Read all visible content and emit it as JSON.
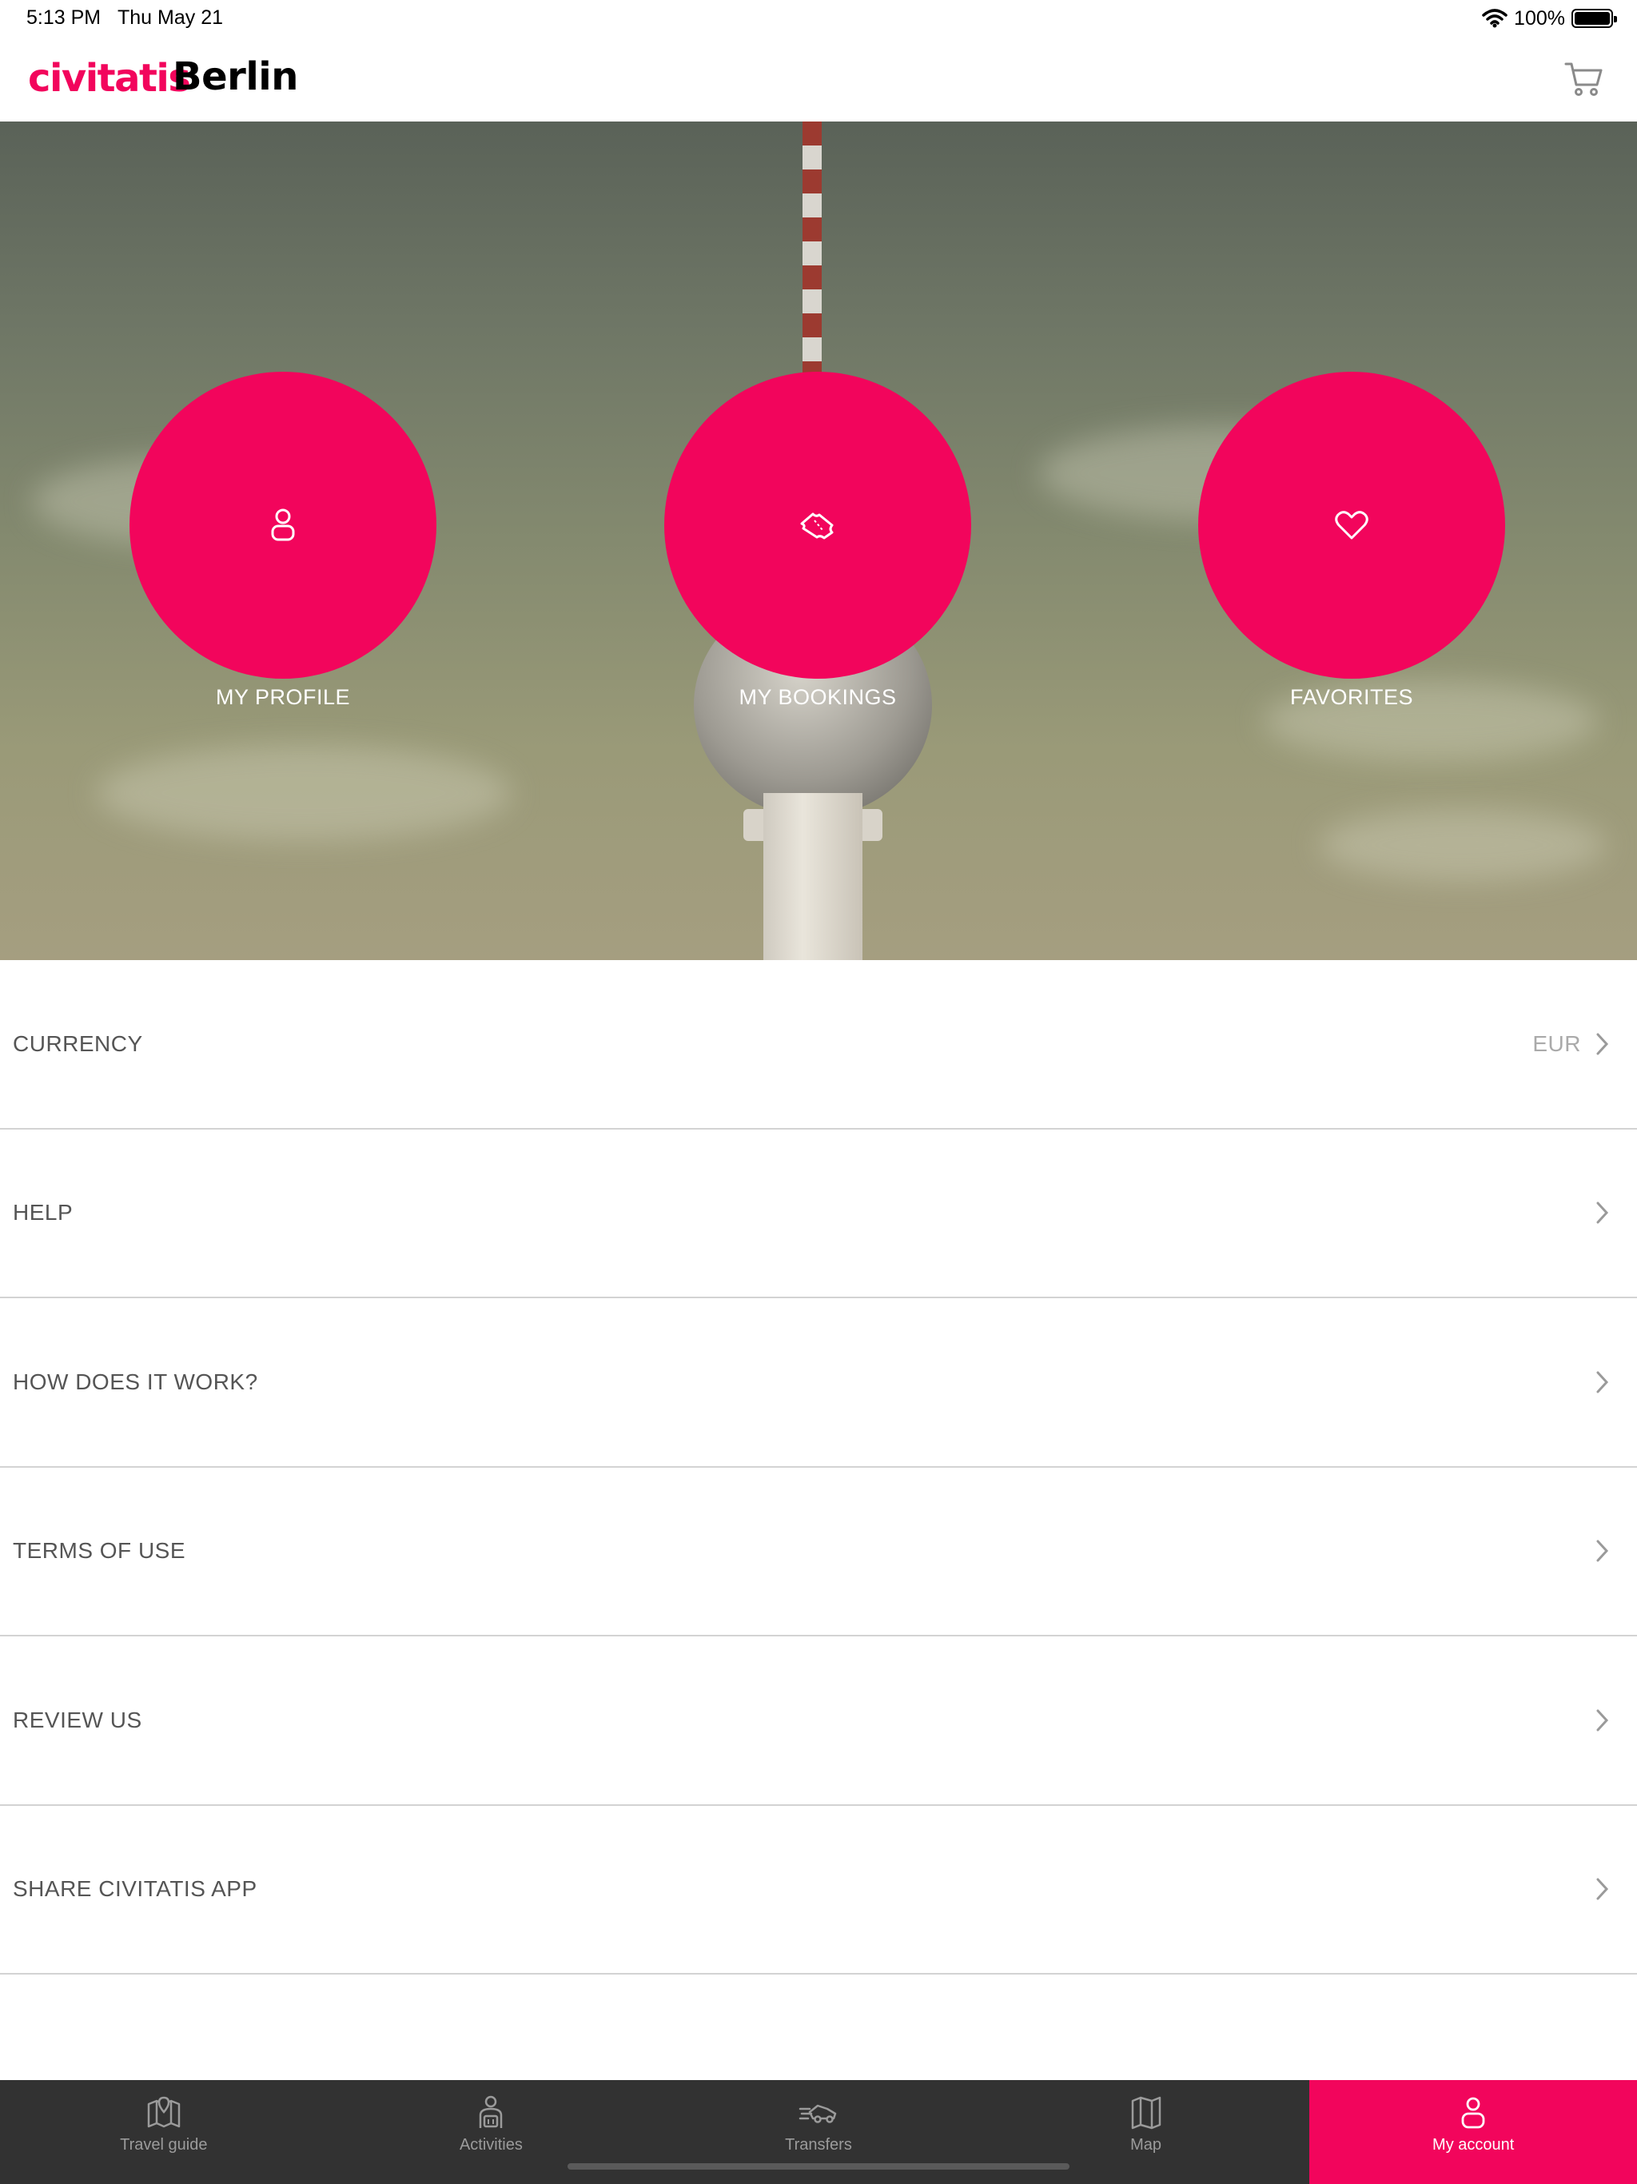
{
  "status_bar": {
    "time": "5:13 PM",
    "date": "Thu May 21",
    "battery": "100%"
  },
  "header": {
    "logo": "civitatis",
    "city": "Berlin"
  },
  "hero": {
    "actions": [
      {
        "label": "MY PROFILE",
        "icon": "person-icon"
      },
      {
        "label": "MY BOOKINGS",
        "icon": "ticket-icon"
      },
      {
        "label": "FAVORITES",
        "icon": "heart-icon"
      }
    ]
  },
  "menu": {
    "items": [
      {
        "label": "CURRENCY",
        "value": "EUR"
      },
      {
        "label": "HELP"
      },
      {
        "label": "HOW DOES IT WORK?"
      },
      {
        "label": "TERMS OF USE"
      },
      {
        "label": "REVIEW US"
      },
      {
        "label": "SHARE CIVITATIS APP"
      }
    ]
  },
  "tabbar": {
    "tabs": [
      {
        "label": "Travel guide",
        "icon": "guide-map-icon"
      },
      {
        "label": "Activities",
        "icon": "traveler-icon"
      },
      {
        "label": "Transfers",
        "icon": "transfer-car-icon"
      },
      {
        "label": "Map",
        "icon": "map-icon"
      },
      {
        "label": "My account",
        "icon": "person-icon",
        "active": true
      }
    ]
  },
  "colors": {
    "brand": "#f2055c",
    "tabbar_bg": "#323232"
  }
}
